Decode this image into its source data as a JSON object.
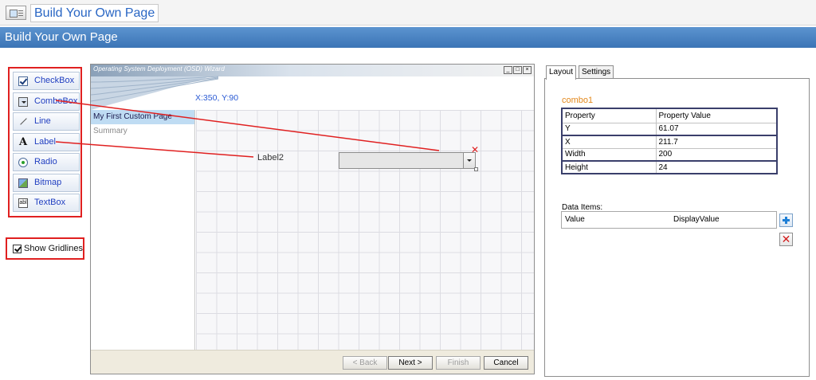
{
  "app": {
    "window_title": "Build Your Own Page",
    "header": "Build Your Own Page",
    "colors": {
      "header_bar": "#4a84c4",
      "annotation_red": "#e02020",
      "link_blue": "#1f3ec0",
      "control_name": "#e3881c"
    }
  },
  "toolbox": {
    "items": [
      {
        "label": "CheckBox",
        "icon": "checkbox-icon"
      },
      {
        "label": "ComboBox",
        "icon": "combobox-icon"
      },
      {
        "label": "Line",
        "icon": "line-icon"
      },
      {
        "label": "Label",
        "icon": "label-icon"
      },
      {
        "label": "Radio",
        "icon": "radio-icon"
      },
      {
        "label": "Bitmap",
        "icon": "bitmap-icon"
      },
      {
        "label": "TextBox",
        "icon": "textbox-icon"
      }
    ],
    "show_gridlines": {
      "label": "Show Gridlines",
      "checked": true
    }
  },
  "wizard": {
    "title": "Operating System Deployment (OSD) Wizard",
    "window_buttons": {
      "minimize": "_",
      "maximize": "□",
      "close": "×"
    },
    "coords": "X:350, Y:90",
    "nav": [
      "My First Custom Page",
      "Summary"
    ],
    "canvas": {
      "label_text": "Label2",
      "combo_close": "✕"
    },
    "buttons": {
      "back": "< Back",
      "next": "Next >",
      "finish": "Finish",
      "cancel": "Cancel"
    }
  },
  "props": {
    "tabs": [
      "Layout",
      "Settings"
    ],
    "control_name": "combo1",
    "table_headers": [
      "Property",
      "Property Value"
    ],
    "rows": [
      {
        "property": "Y",
        "value": "61.07"
      },
      {
        "property": "X",
        "value": "211.7"
      },
      {
        "property": "Width",
        "value": "200"
      },
      {
        "property": "Height",
        "value": "24"
      }
    ],
    "data_items_label": "Data Items:",
    "data_items_headers": [
      "Value",
      "DisplayValue"
    ]
  }
}
